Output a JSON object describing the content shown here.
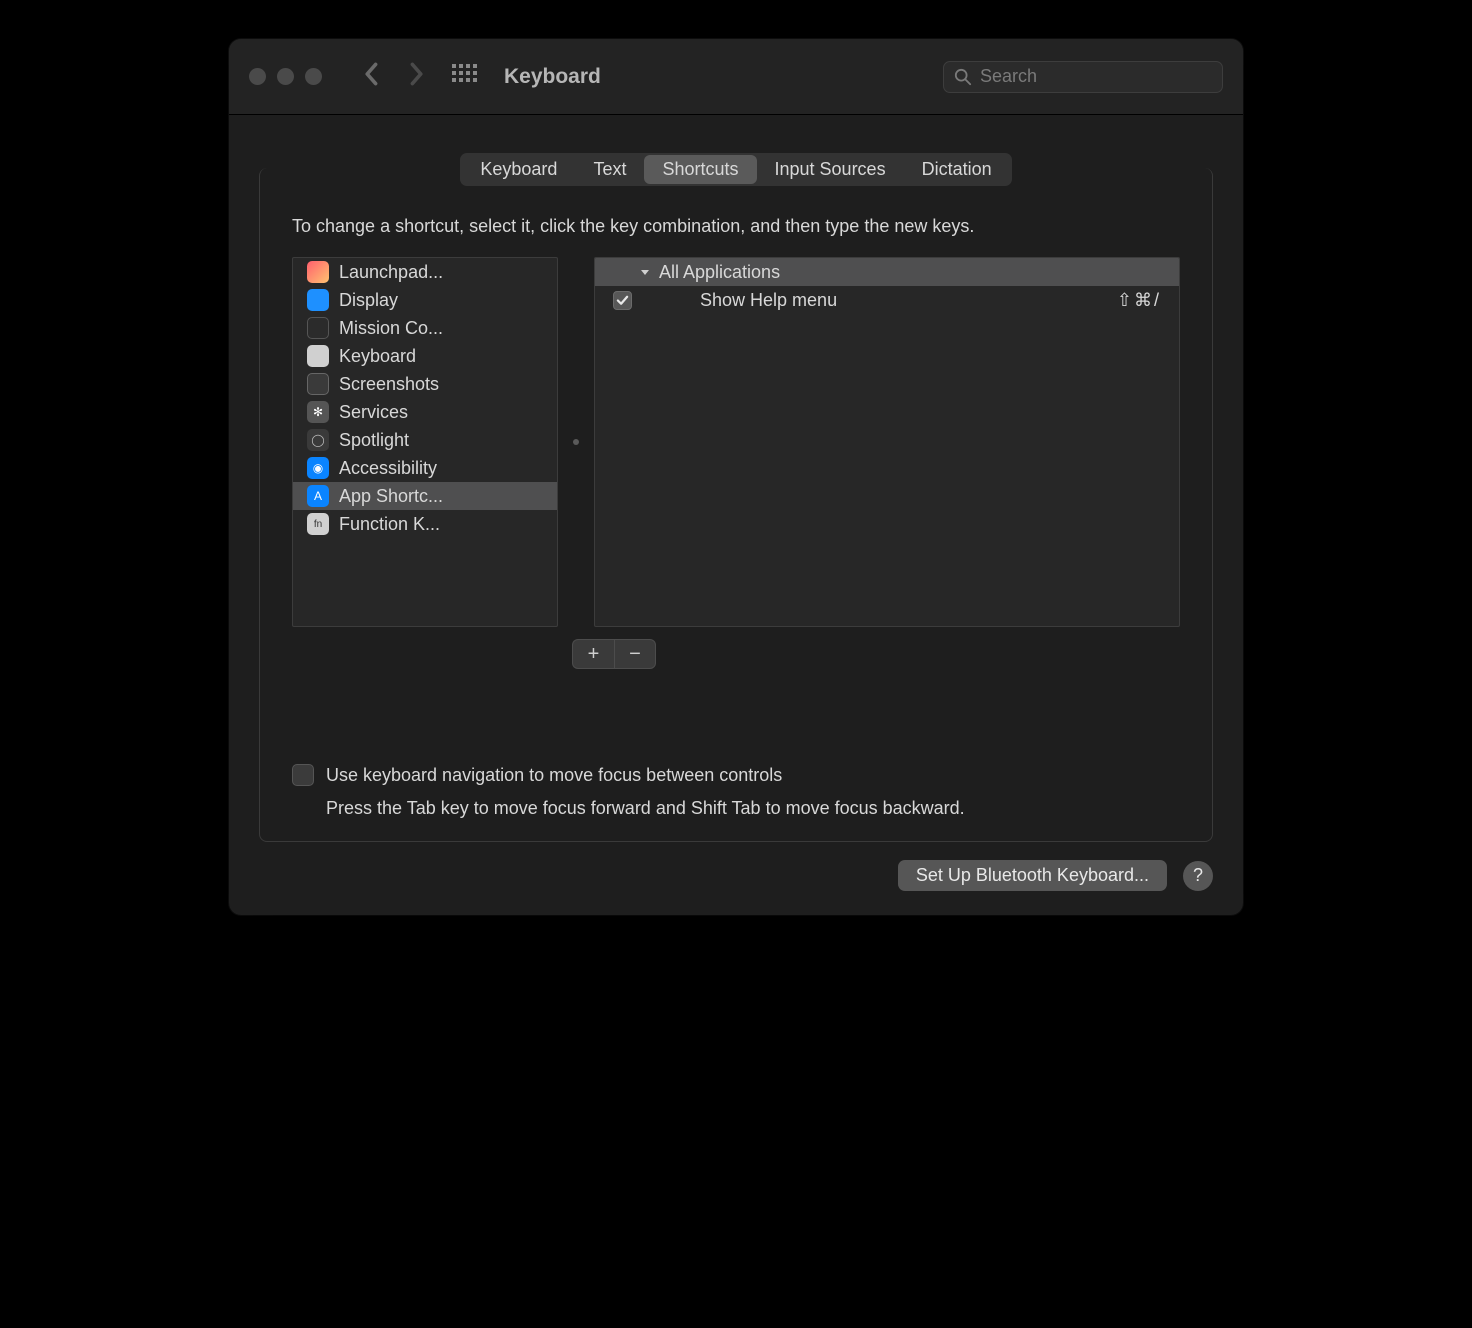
{
  "window_title": "Keyboard",
  "search": {
    "placeholder": "Search"
  },
  "tabs": [
    {
      "label": "Keyboard",
      "active": false
    },
    {
      "label": "Text",
      "active": false
    },
    {
      "label": "Shortcuts",
      "active": true
    },
    {
      "label": "Input Sources",
      "active": false
    },
    {
      "label": "Dictation",
      "active": false
    }
  ],
  "instruction": "To change a shortcut, select it, click the key combination, and then type the new keys.",
  "categories": [
    {
      "label": "Launchpad...",
      "icon": "launchpad",
      "selected": false
    },
    {
      "label": "Display",
      "icon": "display",
      "selected": false
    },
    {
      "label": "Mission Co...",
      "icon": "mission",
      "selected": false
    },
    {
      "label": "Keyboard",
      "icon": "keyboard",
      "selected": false
    },
    {
      "label": "Screenshots",
      "icon": "screenshots",
      "selected": false
    },
    {
      "label": "Services",
      "icon": "services",
      "selected": false
    },
    {
      "label": "Spotlight",
      "icon": "spotlight",
      "selected": false
    },
    {
      "label": "Accessibility",
      "icon": "accessibility",
      "selected": false
    },
    {
      "label": "App Shortc...",
      "icon": "appshortcuts",
      "selected": true
    },
    {
      "label": "Function K...",
      "icon": "fn",
      "selected": false
    }
  ],
  "shortcuts": {
    "group_label": "All Applications",
    "items": [
      {
        "enabled": true,
        "label": "Show Help menu",
        "keys": "⇧⌘/"
      }
    ]
  },
  "addremove": {
    "add": "+",
    "remove": "−"
  },
  "kbdnav_label": "Use keyboard navigation to move focus between controls",
  "kbdnav_desc": "Press the Tab key to move focus forward and Shift Tab to move focus backward.",
  "bluetooth_button": "Set Up Bluetooth Keyboard...",
  "help": "?"
}
